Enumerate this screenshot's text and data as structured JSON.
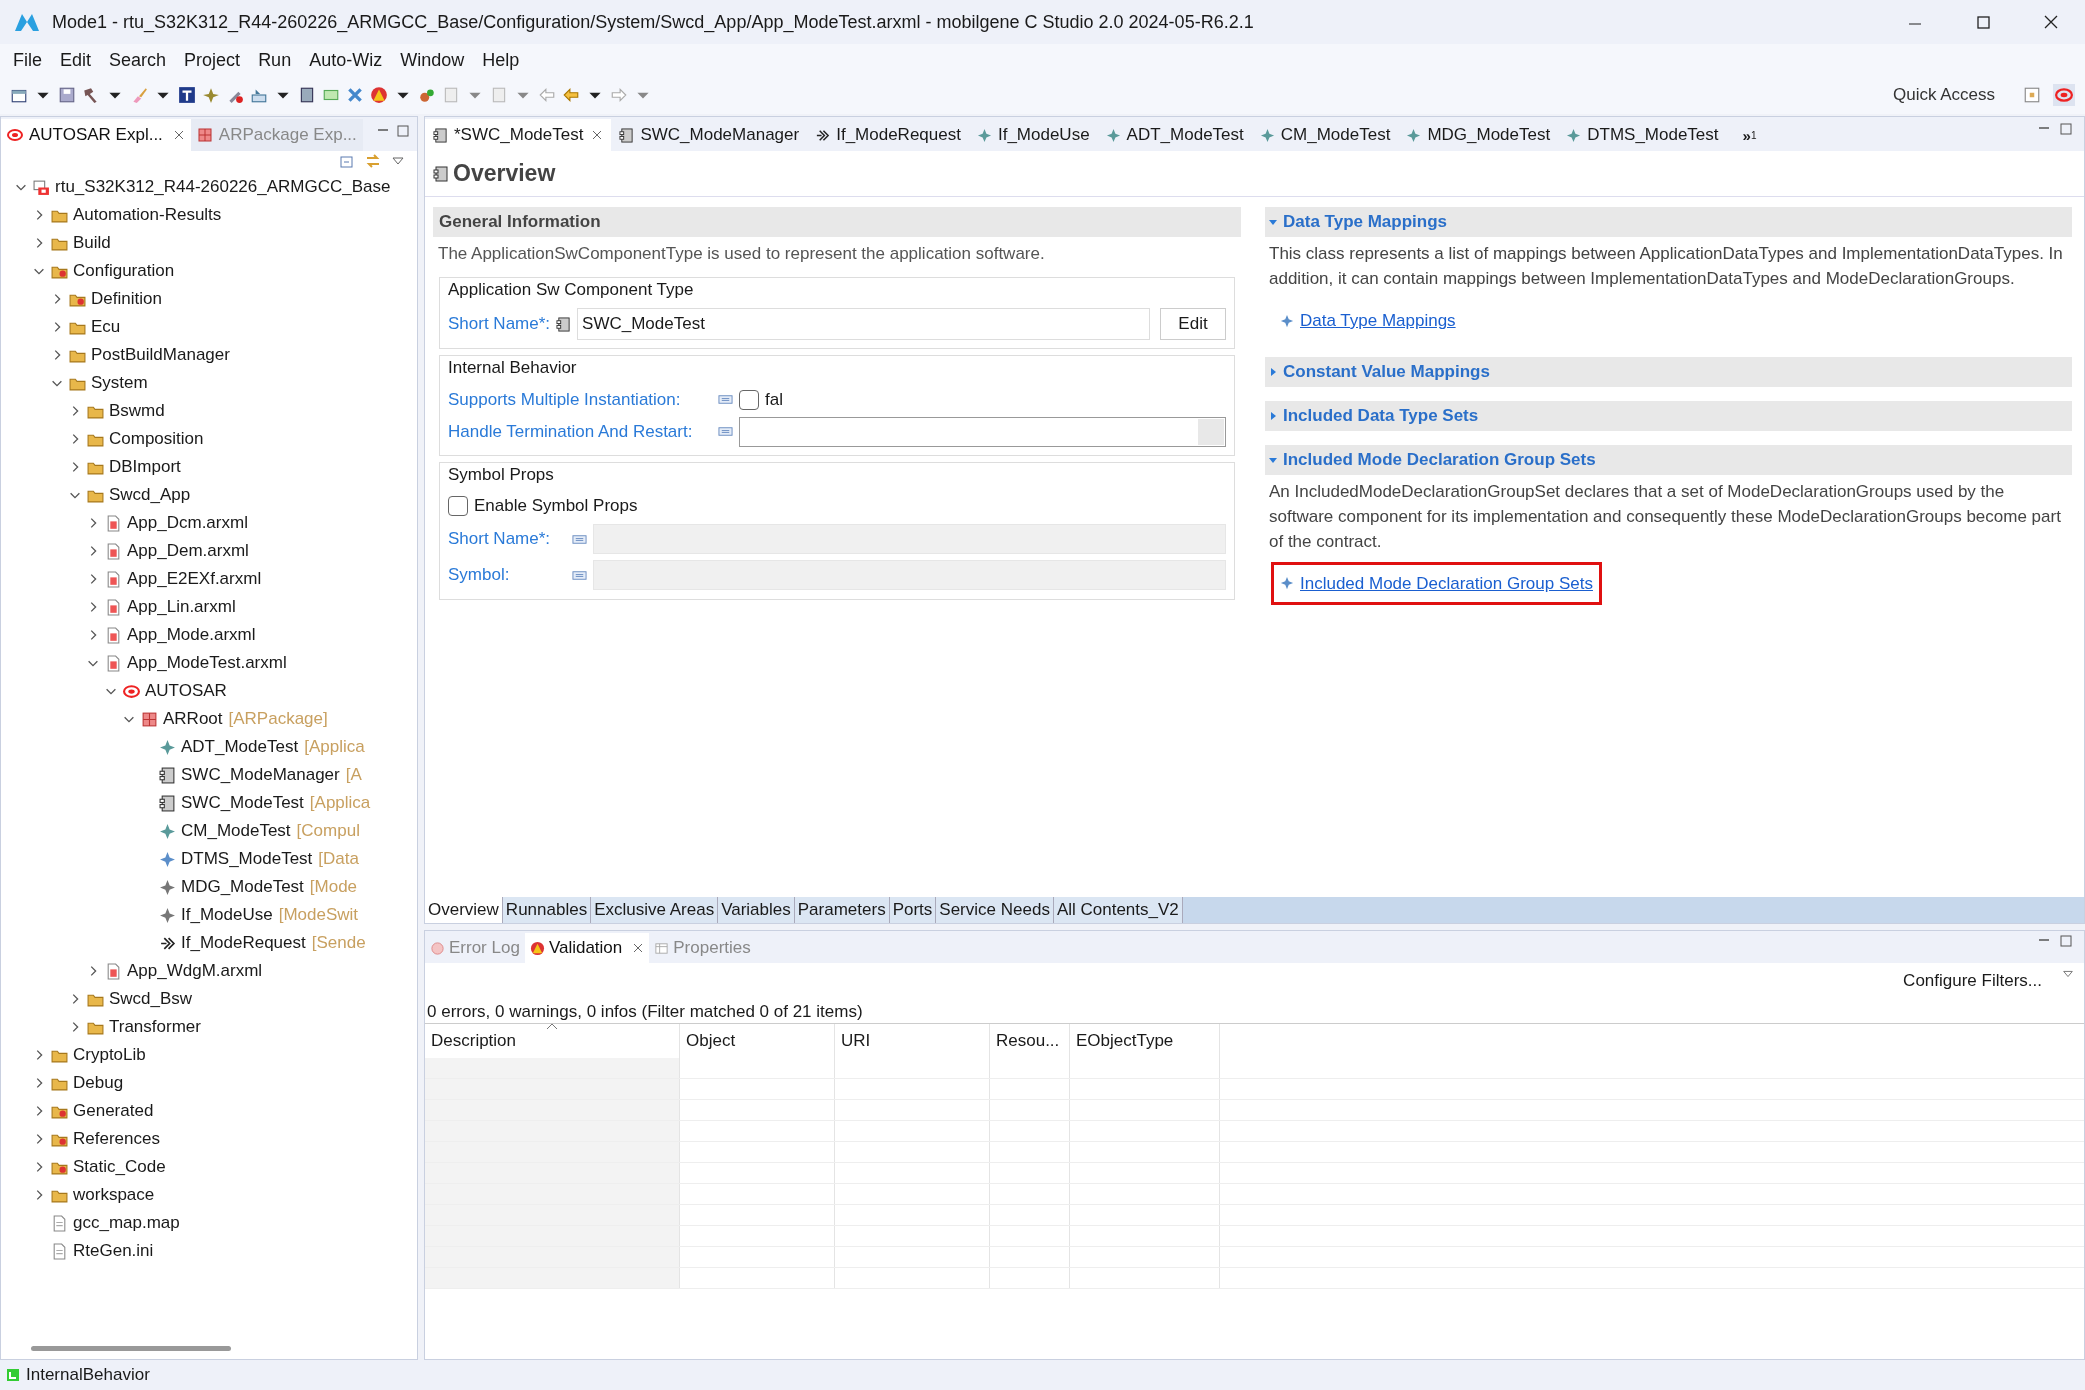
{
  "window": {
    "title": "Mode1 - rtu_S32K312_R44-260226_ARMGCC_Base/Configuration/System/Swcd_App/App_ModeTest.arxml - mobilgene C Studio 2.0 2024-05-R6.2.1"
  },
  "menu": [
    "File",
    "Edit",
    "Search",
    "Project",
    "Run",
    "Auto-Wiz",
    "Window",
    "Help"
  ],
  "quick_access": {
    "placeholder": "Quick Access"
  },
  "explorer": {
    "tabs": [
      {
        "label": "AUTOSAR Expl...",
        "selected": true,
        "kind": "autosar"
      },
      {
        "label": "ARPackage Exp...",
        "selected": false,
        "kind": "package"
      }
    ],
    "tree": [
      {
        "label": "rtu_S32K312_R44-260226_ARMGCC_Base",
        "kind": "project",
        "expanded": true,
        "children": [
          {
            "label": "Automation-Results",
            "kind": "folder",
            "expanded": false
          },
          {
            "label": "Build",
            "kind": "folder",
            "expanded": false
          },
          {
            "label": "Configuration",
            "kind": "folder-red",
            "expanded": true,
            "children": [
              {
                "label": "Definition",
                "kind": "folder-red",
                "expanded": false
              },
              {
                "label": "Ecu",
                "kind": "folder",
                "expanded": false
              },
              {
                "label": "PostBuildManager",
                "kind": "folder",
                "expanded": false
              },
              {
                "label": "System",
                "kind": "folder",
                "expanded": true,
                "children": [
                  {
                    "label": "Bswmd",
                    "kind": "folder",
                    "expanded": false
                  },
                  {
                    "label": "Composition",
                    "kind": "folder",
                    "expanded": false
                  },
                  {
                    "label": "DBImport",
                    "kind": "folder",
                    "expanded": false
                  },
                  {
                    "label": "Swcd_App",
                    "kind": "folder",
                    "expanded": true,
                    "children": [
                      {
                        "label": "App_Dcm.arxml",
                        "kind": "arxml",
                        "expanded": false
                      },
                      {
                        "label": "App_Dem.arxml",
                        "kind": "arxml",
                        "expanded": false
                      },
                      {
                        "label": "App_E2EXf.arxml",
                        "kind": "arxml",
                        "expanded": false
                      },
                      {
                        "label": "App_Lin.arxml",
                        "kind": "arxml",
                        "expanded": false
                      },
                      {
                        "label": "App_Mode.arxml",
                        "kind": "arxml",
                        "expanded": false
                      },
                      {
                        "label": "App_ModeTest.arxml",
                        "kind": "arxml",
                        "expanded": true,
                        "children": [
                          {
                            "label": "AUTOSAR",
                            "kind": "autosar",
                            "expanded": true,
                            "children": [
                              {
                                "label": "ARRoot",
                                "suffix": "[ARPackage]",
                                "kind": "package",
                                "expanded": true,
                                "children": [
                                  {
                                    "label": "ADT_ModeTest",
                                    "suffix": "[Applica",
                                    "kind": "element"
                                  },
                                  {
                                    "label": "SWC_ModeManager",
                                    "suffix": "[A",
                                    "kind": "component"
                                  },
                                  {
                                    "label": "SWC_ModeTest",
                                    "suffix": "[Applica",
                                    "kind": "component"
                                  },
                                  {
                                    "label": "CM_ModeTest",
                                    "suffix": "[Compul",
                                    "kind": "element"
                                  },
                                  {
                                    "label": "DTMS_ModeTest",
                                    "suffix": "[Data",
                                    "kind": "element-blue"
                                  },
                                  {
                                    "label": "MDG_ModeTest",
                                    "suffix": "[Mode",
                                    "kind": "element-grey"
                                  },
                                  {
                                    "label": "If_ModeUse",
                                    "suffix": "[ModeSwit",
                                    "kind": "element-grey"
                                  },
                                  {
                                    "label": "If_ModeRequest",
                                    "suffix": "[Sende",
                                    "kind": "interface"
                                  }
                                ]
                              }
                            ]
                          }
                        ]
                      },
                      {
                        "label": "App_WdgM.arxml",
                        "kind": "arxml",
                        "expanded": false
                      }
                    ]
                  },
                  {
                    "label": "Swcd_Bsw",
                    "kind": "folder",
                    "expanded": false
                  },
                  {
                    "label": "Transformer",
                    "kind": "folder",
                    "expanded": false
                  }
                ]
              }
            ]
          },
          {
            "label": "CryptoLib",
            "kind": "folder",
            "expanded": false
          },
          {
            "label": "Debug",
            "kind": "folder",
            "expanded": false
          },
          {
            "label": "Generated",
            "kind": "folder-red",
            "expanded": false
          },
          {
            "label": "References",
            "kind": "folder-red",
            "expanded": false
          },
          {
            "label": "Static_Code",
            "kind": "folder-red",
            "expanded": false
          },
          {
            "label": "workspace",
            "kind": "folder",
            "expanded": false
          },
          {
            "label": "gcc_map.map",
            "kind": "file"
          },
          {
            "label": "RteGen.ini",
            "kind": "file"
          }
        ]
      }
    ]
  },
  "editor_tabs": [
    {
      "label": "*SWC_ModeTest",
      "kind": "component",
      "selected": true
    },
    {
      "label": "SWC_ModeManager",
      "kind": "component",
      "selected": false
    },
    {
      "label": "If_ModeRequest",
      "kind": "interface",
      "selected": false
    },
    {
      "label": "If_ModeUse",
      "kind": "element",
      "selected": false
    },
    {
      "label": "ADT_ModeTest",
      "kind": "element",
      "selected": false
    },
    {
      "label": "CM_ModeTest",
      "kind": "element",
      "selected": false
    },
    {
      "label": "MDG_ModeTest",
      "kind": "element",
      "selected": false
    },
    {
      "label": "DTMS_ModeTest",
      "kind": "element",
      "selected": false
    }
  ],
  "more_tabs": "»",
  "more_tabs_count": "1",
  "page_title": "Overview",
  "general": {
    "title": "General Information",
    "description": "The ApplicationSwComponentType is used to represent the application software.",
    "component_group": {
      "title": "Application Sw Component Type",
      "short_name_label": "Short Name*:",
      "short_name_value": "SWC_ModeTest",
      "edit_button": "Edit"
    },
    "internal_behavior": {
      "title": "Internal Behavior",
      "supports_label": "Supports Multiple Instantiation:",
      "supports_checked": false,
      "supports_text": "fal",
      "handle_label": "Handle Termination And Restart:"
    },
    "symbol_props": {
      "title": "Symbol Props",
      "enable_label": "Enable Symbol Props",
      "enable_checked": false,
      "short_name_label": "Short Name*:",
      "symbol_label": "Symbol:",
      "disabled": true
    }
  },
  "sections": [
    {
      "title": "Data Type Mappings",
      "expanded": true,
      "description": "This class represents a list of mappings between ApplicationDataTypes and ImplementationDataTypes. In addition, it can contain mappings between ImplementationDataTypes and ModeDeclarationGroups.",
      "link": "Data Type Mappings",
      "highlighted": false
    },
    {
      "title": "Constant Value Mappings",
      "expanded": false
    },
    {
      "title": "Included Data Type Sets",
      "expanded": false
    },
    {
      "title": "Included Mode Declaration Group Sets",
      "expanded": true,
      "description": "An IncludedModeDeclarationGroupSet declares that a set of ModeDeclarationGroups used by the software component for its implementation and consequently these ModeDeclarationGroups become part of the contract.",
      "link": "Included Mode Declaration Group Sets",
      "highlighted": true
    }
  ],
  "page_tabs": [
    {
      "label": "Overview",
      "selected": true
    },
    {
      "label": "Runnables",
      "selected": false
    },
    {
      "label": "Exclusive Areas",
      "selected": false
    },
    {
      "label": "Variables",
      "selected": false
    },
    {
      "label": "Parameters",
      "selected": false
    },
    {
      "label": "Ports",
      "selected": false
    },
    {
      "label": "Service Needs",
      "selected": false
    },
    {
      "label": "All Contents_V2",
      "selected": false
    }
  ],
  "bottom_tabs": [
    {
      "label": "Error Log",
      "kind": "error-log",
      "selected": false
    },
    {
      "label": "Validation",
      "kind": "validation",
      "selected": true
    },
    {
      "label": "Properties",
      "kind": "properties",
      "selected": false
    }
  ],
  "configure_filters": "Configure Filters...",
  "summary": "0 errors, 0 warnings, 0 infos (Filter matched 0 of 21 items)",
  "table": {
    "columns": [
      {
        "label": "Description",
        "sorted": true
      },
      {
        "label": "Object",
        "sorted": false
      },
      {
        "label": "URI",
        "sorted": false
      },
      {
        "label": "Resou...",
        "sorted": false
      },
      {
        "label": "EObjectType",
        "sorted": false
      }
    ]
  },
  "status_bar": {
    "text": "InternalBehavior"
  }
}
